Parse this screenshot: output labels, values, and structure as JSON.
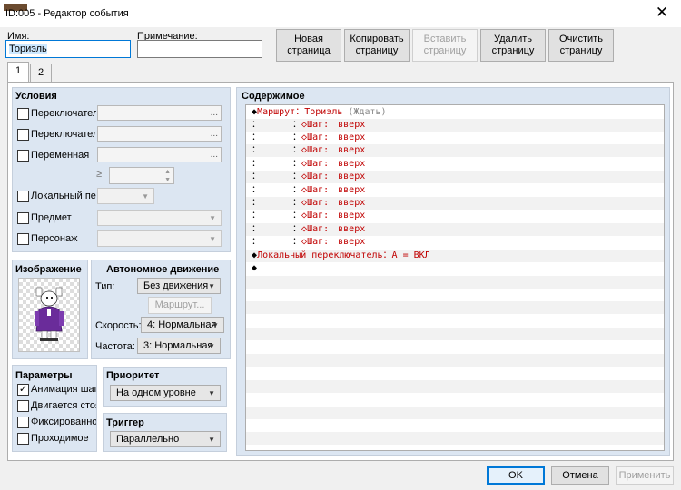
{
  "window": {
    "title": "ID:005 - Редактор события",
    "close_glyph": "✕"
  },
  "header": {
    "name_label": "Имя:",
    "name_value": "Ториэль",
    "note_label": "Примечание:",
    "note_value": ""
  },
  "toolbar": {
    "new_page": "Новая\nстраница",
    "copy_page": "Копировать\nстраницу",
    "paste_page": "Вставить\nстраницу",
    "delete_page": "Удалить\nстраницу",
    "clear_page": "Очистить\nстраницу"
  },
  "tabs": [
    {
      "label": "1",
      "active": true
    },
    {
      "label": "2",
      "active": false
    }
  ],
  "conditions": {
    "title": "Условия",
    "switch1_label": "Переключатель",
    "switch2_label": "Переключатель",
    "variable_label": "Переменная",
    "gte_symbol": "≥",
    "self_switch_label": "Локальный пере",
    "item_label": "Предмет",
    "actor_label": "Персонаж",
    "ellipsis": "..."
  },
  "image": {
    "title": "Изображение",
    "sprite_icon": "character-sprite-icon"
  },
  "autonomous": {
    "title": "Автономное движение",
    "type_label": "Тип:",
    "type_value": "Без движения",
    "route_button": "Маршрут...",
    "speed_label": "Скорость:",
    "speed_value": "4: Нормальная",
    "freq_label": "Частота:",
    "freq_value": "3: Нормальная"
  },
  "options": {
    "title": "Параметры",
    "items": [
      {
        "label": "Анимация шага",
        "checked": true
      },
      {
        "label": "Двигается стоя",
        "checked": false
      },
      {
        "label": "Фиксированное",
        "checked": false
      },
      {
        "label": "Проходимое",
        "checked": false
      }
    ]
  },
  "priority": {
    "title": "Приоритет",
    "value": "На одном уровне"
  },
  "trigger": {
    "title": "Триггер",
    "value": "Параллельно"
  },
  "contents": {
    "title": "Содержимое",
    "route_marker": "◆",
    "route_cmd": "Маршрут",
    "route_sep": "：",
    "route_target": "Ториэль",
    "route_wait": " (Ждать)",
    "step_prefix": "：　　　　：",
    "step_marker": "◇",
    "step_text": "Шаг:　вверх",
    "self_switch_cmd": "Локальный переключатель：A = ВКЛ",
    "end_marker": "◆"
  },
  "footer": {
    "ok": "OK",
    "cancel": "Отмена",
    "apply": "Применить"
  },
  "colors": {
    "command_red": "#c00000",
    "panel_bg": "#dce6f2",
    "focus_blue": "#0078d7"
  }
}
